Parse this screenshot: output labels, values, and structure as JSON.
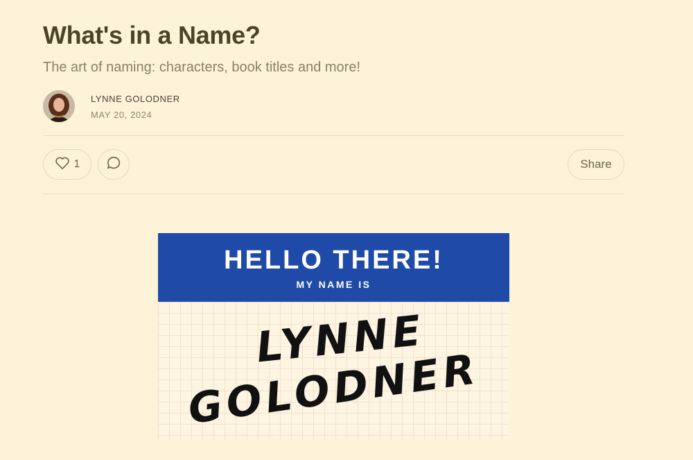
{
  "post": {
    "title": "What's in a Name?",
    "subtitle": "The art of naming: characters, book titles and more!"
  },
  "author": {
    "name": "LYNNE GOLODNER",
    "date": "MAY 20, 2024"
  },
  "actions": {
    "like_count": "1",
    "share_label": "Share",
    "icons": [
      "heart-icon",
      "comment-icon"
    ]
  },
  "image": {
    "header_text": "HELLO THERE!",
    "subheader_text": "MY NAME IS",
    "name_line1": "LYNNE",
    "name_line2": "GOLODNER",
    "header_color": "#1f4aa8"
  }
}
